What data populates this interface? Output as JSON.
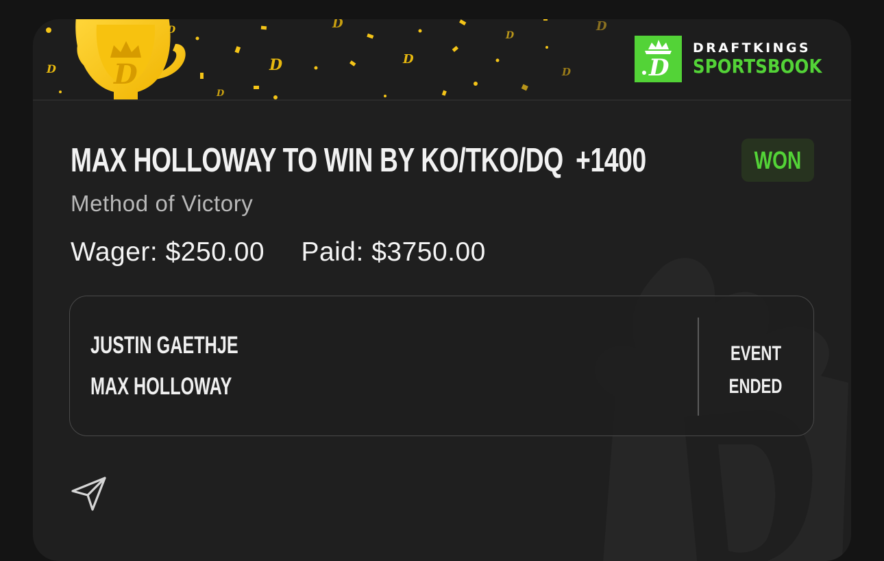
{
  "banner": {
    "brand_top": "DRAFTKINGS",
    "brand_bottom": "SPORTSBOOK",
    "logo_icon": "draftkings-crown-icon",
    "trophy_icon": "trophy-icon"
  },
  "bet": {
    "selection": "MAX HOLLOWAY TO WIN BY KO/TKO/DQ",
    "odds": "+1400",
    "status": "WON",
    "market": "Method of Victory",
    "wager_label": "Wager:",
    "wager_amount": "$250.00",
    "paid_label": "Paid:",
    "paid_amount": "$3750.00"
  },
  "event": {
    "fighters": [
      "JUSTIN GAETHJE",
      "MAX HOLLOWAY"
    ],
    "status_line1": "EVENT",
    "status_line2": "ENDED"
  },
  "actions": {
    "share_icon": "send-icon"
  },
  "colors": {
    "background": "#141414",
    "card": "#1f1f1f",
    "accent_green": "#53d337",
    "won_badge_bg": "#27331f",
    "gold": "#f5c518"
  }
}
